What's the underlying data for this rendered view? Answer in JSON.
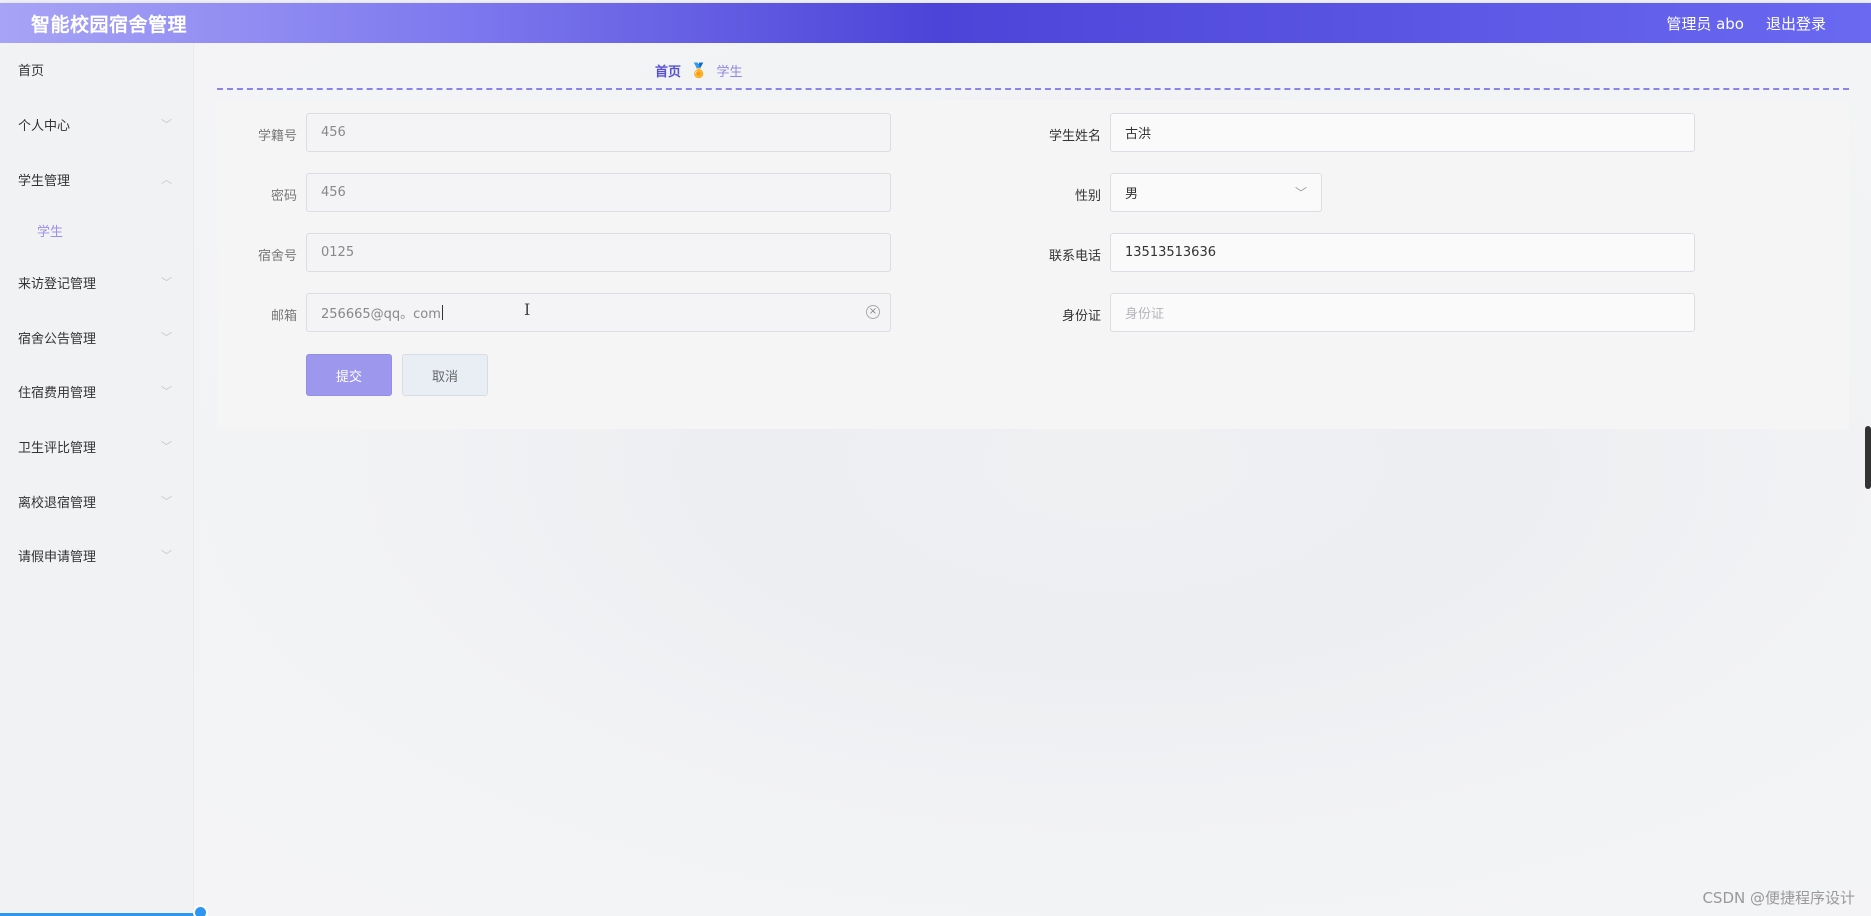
{
  "header": {
    "app_title": "智能校园宿舍管理",
    "user_label": "管理员 abo",
    "logout_label": "退出登录"
  },
  "sidebar": {
    "items": [
      {
        "label": "首页",
        "expandable": false
      },
      {
        "label": "个人中心",
        "expandable": true
      },
      {
        "label": "学生管理",
        "expandable": true,
        "expanded": true
      },
      {
        "label": "来访登记管理",
        "expandable": true
      },
      {
        "label": "宿舍公告管理",
        "expandable": true
      },
      {
        "label": "住宿费用管理",
        "expandable": true
      },
      {
        "label": "卫生评比管理",
        "expandable": true
      },
      {
        "label": "离校退宿管理",
        "expandable": true
      },
      {
        "label": "请假申请管理",
        "expandable": true
      }
    ],
    "sub_item": "学生"
  },
  "breadcrumb": {
    "home": "首页",
    "current": "学生"
  },
  "form": {
    "student_id": {
      "label": "学籍号",
      "value": "456"
    },
    "student_name": {
      "label": "学生姓名",
      "value": "古洪"
    },
    "password": {
      "label": "密码",
      "value": "456"
    },
    "gender": {
      "label": "性别",
      "value": "男"
    },
    "dorm_no": {
      "label": "宿舍号",
      "value": "0125"
    },
    "phone": {
      "label": "联系电话",
      "value": "13513513636"
    },
    "email": {
      "label": "邮箱",
      "value": "256665@qq。com"
    },
    "id_card": {
      "label": "身份证",
      "placeholder": "身份证"
    },
    "submit_label": "提交",
    "cancel_label": "取消"
  },
  "watermark": "CSDN @便捷程序设计",
  "colors": {
    "accent": "#5650d6",
    "submit_button": "#9d97ee",
    "header_gradient_mid": "#4c44d8"
  }
}
